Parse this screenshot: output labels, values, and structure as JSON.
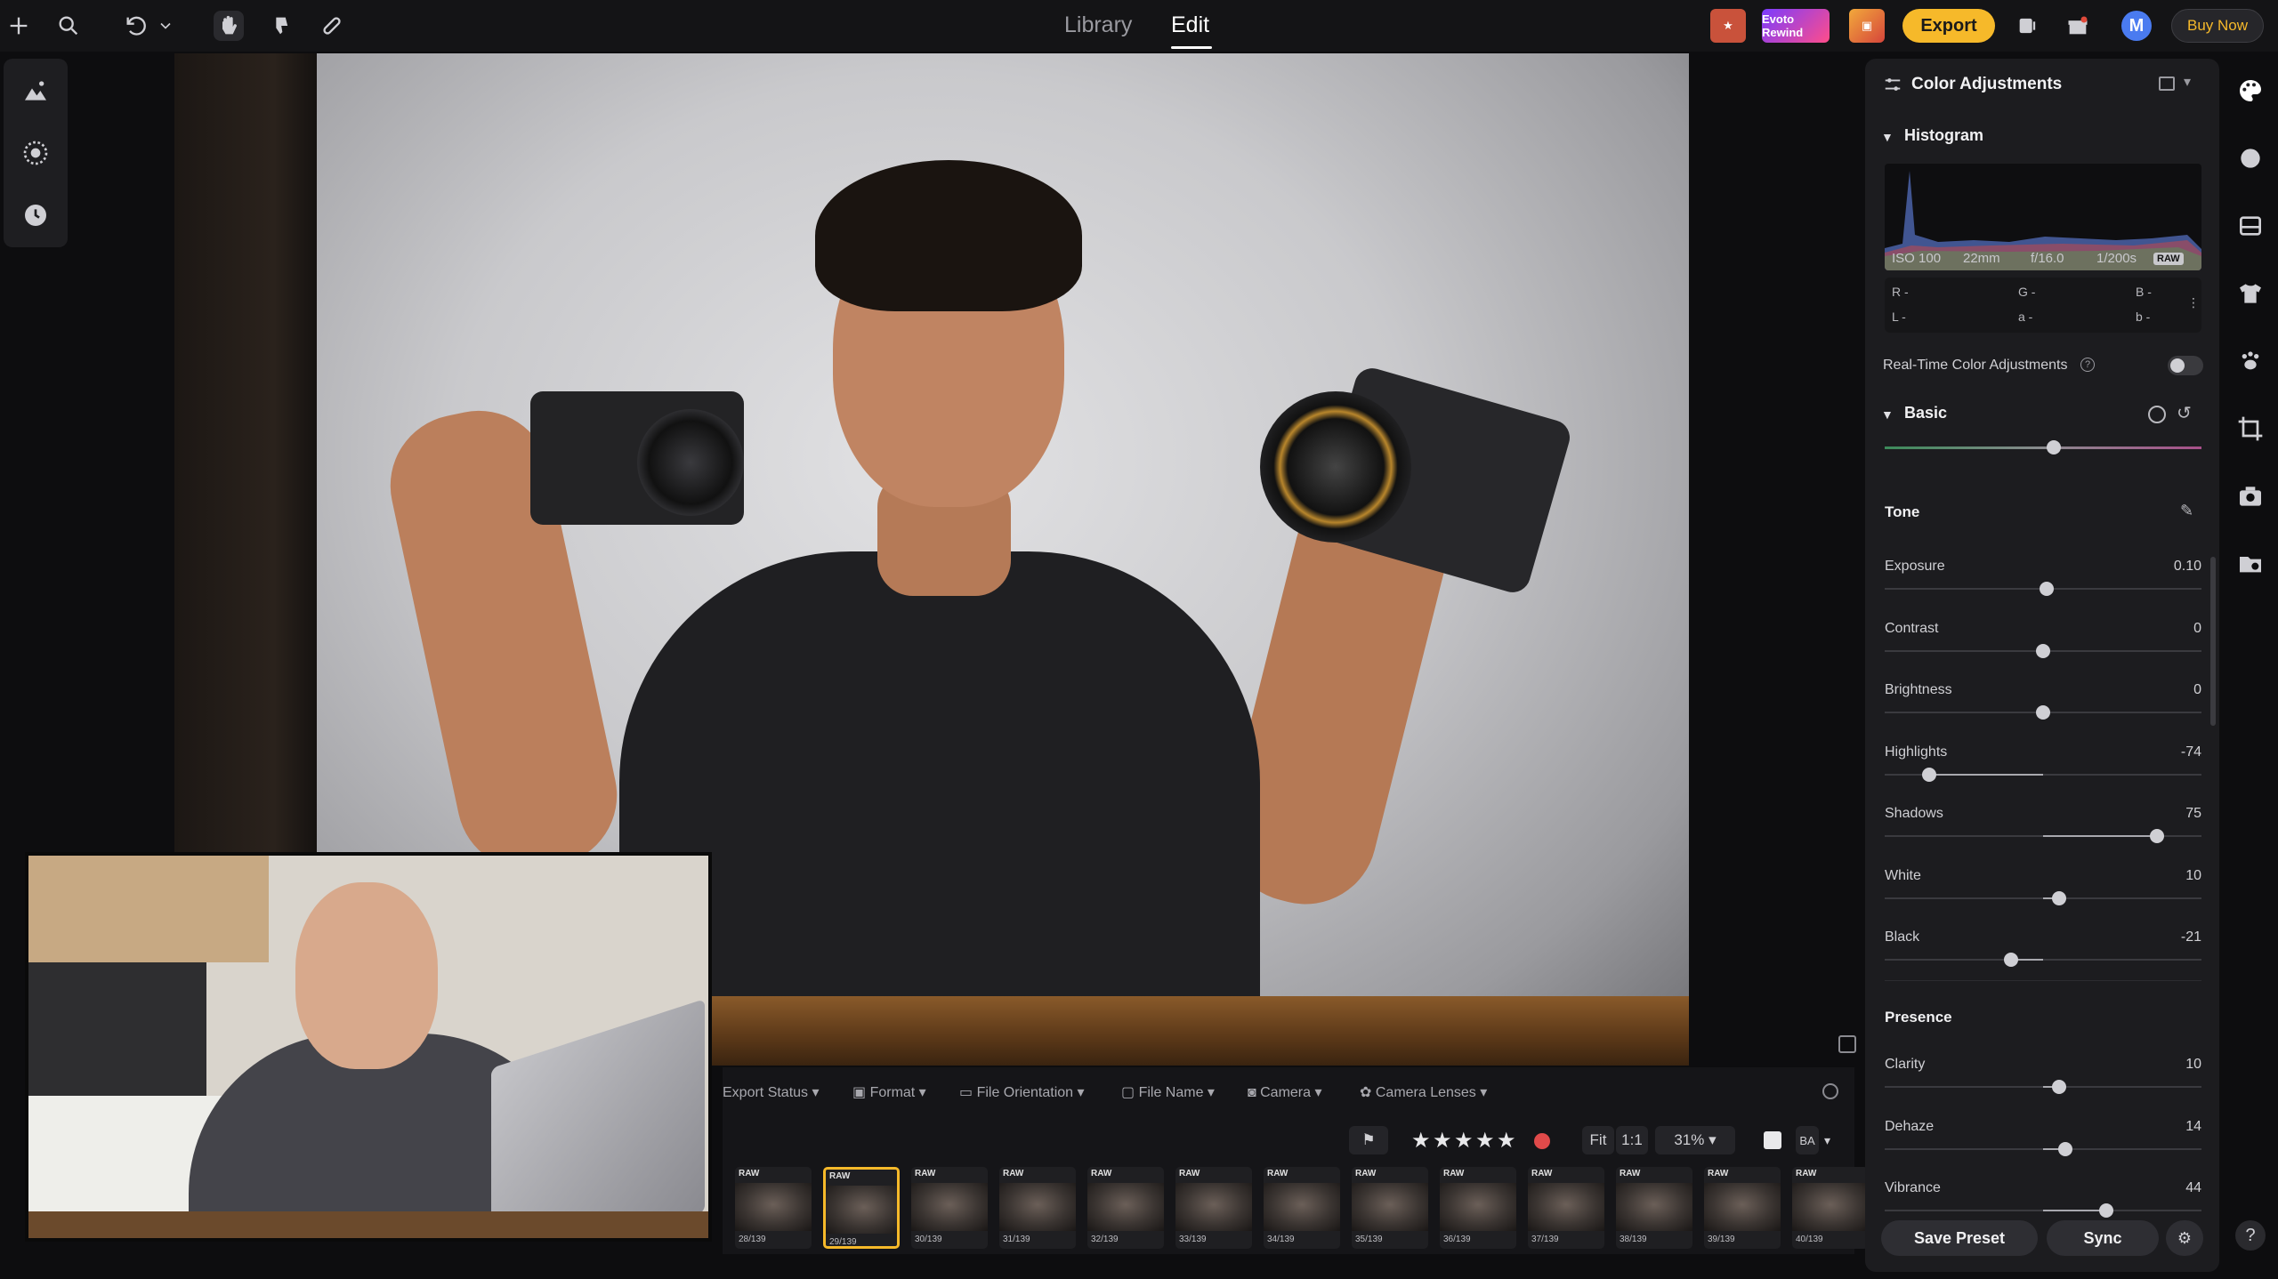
{
  "nav": {
    "library": "Library",
    "edit": "Edit"
  },
  "toolbar": {
    "export_label": "Export",
    "buy_now_label": "Buy Now",
    "avatar_initial": "M",
    "promo_rewind": "Evoto Rewind"
  },
  "panel": {
    "title": "Color Adjustments",
    "histogram": {
      "title": "Histogram",
      "iso": "ISO 100",
      "focal": "22mm",
      "aperture": "f/16.0",
      "shutter": "1/200s",
      "raw": "RAW",
      "r": "R -",
      "g": "G -",
      "b": "B -",
      "l": "L -",
      "a": "a -",
      "bb": "b -"
    },
    "realtime_label": "Real-Time Color Adjustments",
    "basic_title": "Basic",
    "tone_title": "Tone",
    "tone": [
      {
        "label": "Exposure",
        "value": "0.10",
        "pos": 0.51
      },
      {
        "label": "Contrast",
        "value": "0",
        "pos": 0.5
      },
      {
        "label": "Brightness",
        "value": "0",
        "pos": 0.5
      },
      {
        "label": "Highlights",
        "value": "-74",
        "pos": 0.14
      },
      {
        "label": "Shadows",
        "value": "75",
        "pos": 0.86
      },
      {
        "label": "White",
        "value": "10",
        "pos": 0.55
      },
      {
        "label": "Black",
        "value": "-21",
        "pos": 0.4
      }
    ],
    "presence_title": "Presence",
    "presence": [
      {
        "label": "Clarity",
        "value": "10",
        "pos": 0.55
      },
      {
        "label": "Dehaze",
        "value": "14",
        "pos": 0.57
      },
      {
        "label": "Vibrance",
        "value": "44",
        "pos": 0.7
      }
    ],
    "save_preset_label": "Save Preset",
    "sync_label": "Sync"
  },
  "filters": {
    "export_status": "Export Status",
    "format": "Format",
    "file_orientation": "File Orientation",
    "file_name": "File Name",
    "camera": "Camera",
    "camera_lenses": "Camera Lenses"
  },
  "view": {
    "fit": "Fit",
    "one_to_one": "1:1",
    "zoom": "31%"
  },
  "thumbnails": [
    {
      "tag": "RAW",
      "num": "28/139"
    },
    {
      "tag": "RAW",
      "num": "29/139",
      "selected": true
    },
    {
      "tag": "RAW",
      "num": "30/139"
    },
    {
      "tag": "RAW",
      "num": "31/139"
    },
    {
      "tag": "RAW",
      "num": "32/139"
    },
    {
      "tag": "RAW",
      "num": "33/139"
    },
    {
      "tag": "RAW",
      "num": "34/139"
    },
    {
      "tag": "RAW",
      "num": "35/139"
    },
    {
      "tag": "RAW",
      "num": "36/139"
    },
    {
      "tag": "RAW",
      "num": "37/139"
    },
    {
      "tag": "RAW",
      "num": "38/139"
    },
    {
      "tag": "RAW",
      "num": "39/139"
    },
    {
      "tag": "RAW",
      "num": "40/139"
    }
  ]
}
